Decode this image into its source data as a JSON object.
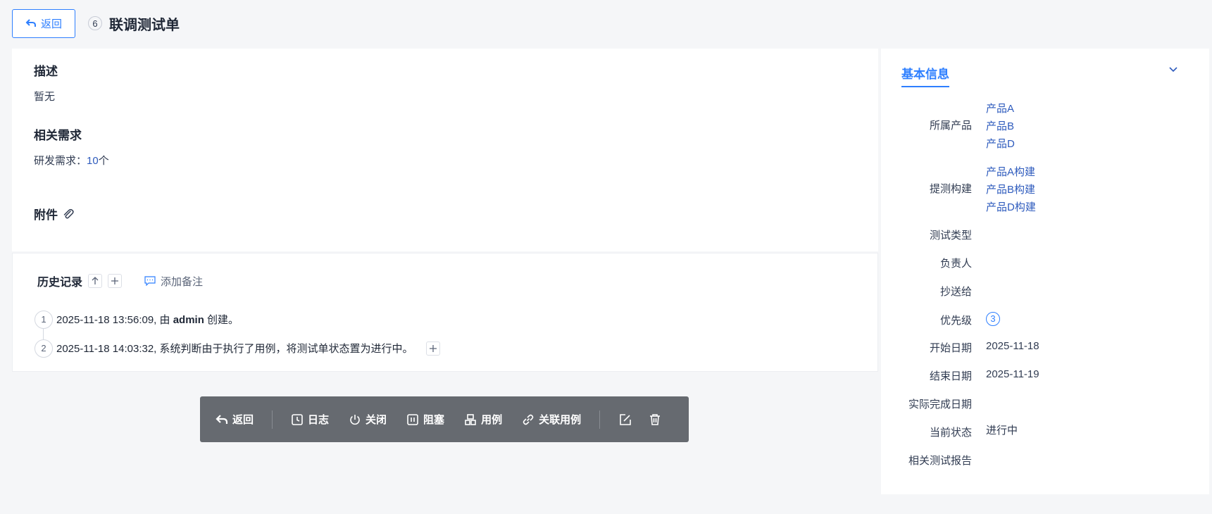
{
  "header": {
    "back_label": "返回",
    "id": "6",
    "title": "联调测试单"
  },
  "main": {
    "desc_title": "描述",
    "desc_text": "暂无",
    "req_title": "相关需求",
    "req_label": "研发需求：",
    "req_count": "10",
    "req_unit": "个",
    "attach_title": "附件"
  },
  "history": {
    "title": "历史记录",
    "sort_icon": "arrow-up-icon",
    "expand_icon": "plus-icon",
    "add_note_label": "添加备注",
    "items": [
      {
        "num": "1",
        "prefix": "2025-11-18 13:56:09, 由 ",
        "user": "admin",
        "suffix": " 创建。"
      },
      {
        "num": "2",
        "text": "2025-11-18 14:03:32, 系统判断由于执行了用例，将测试单状态置为进行中。"
      }
    ]
  },
  "toolbar": {
    "back": "返回",
    "log": "日志",
    "close": "关闭",
    "block": "阻塞",
    "cases": "用例",
    "link_cases": "关联用例"
  },
  "side": {
    "tab": "基本信息",
    "labels": {
      "product": "所属产品",
      "build": "提测构建",
      "type": "测试类型",
      "owner": "负责人",
      "cc": "抄送给",
      "priority": "优先级",
      "start": "开始日期",
      "end": "结束日期",
      "actual": "实际完成日期",
      "status": "当前状态",
      "report": "相关测试报告"
    },
    "products": [
      "产品A",
      "产品B",
      "产品D"
    ],
    "builds": [
      "产品A构建",
      "产品B构建",
      "产品D构建"
    ],
    "priority": "3",
    "start_date": "2025-11-18",
    "end_date": "2025-11-19",
    "status": "进行中"
  },
  "colors": {
    "accent": "#2e7fff",
    "link": "#2e5bbd",
    "toolbar_bg": "#666a70"
  }
}
